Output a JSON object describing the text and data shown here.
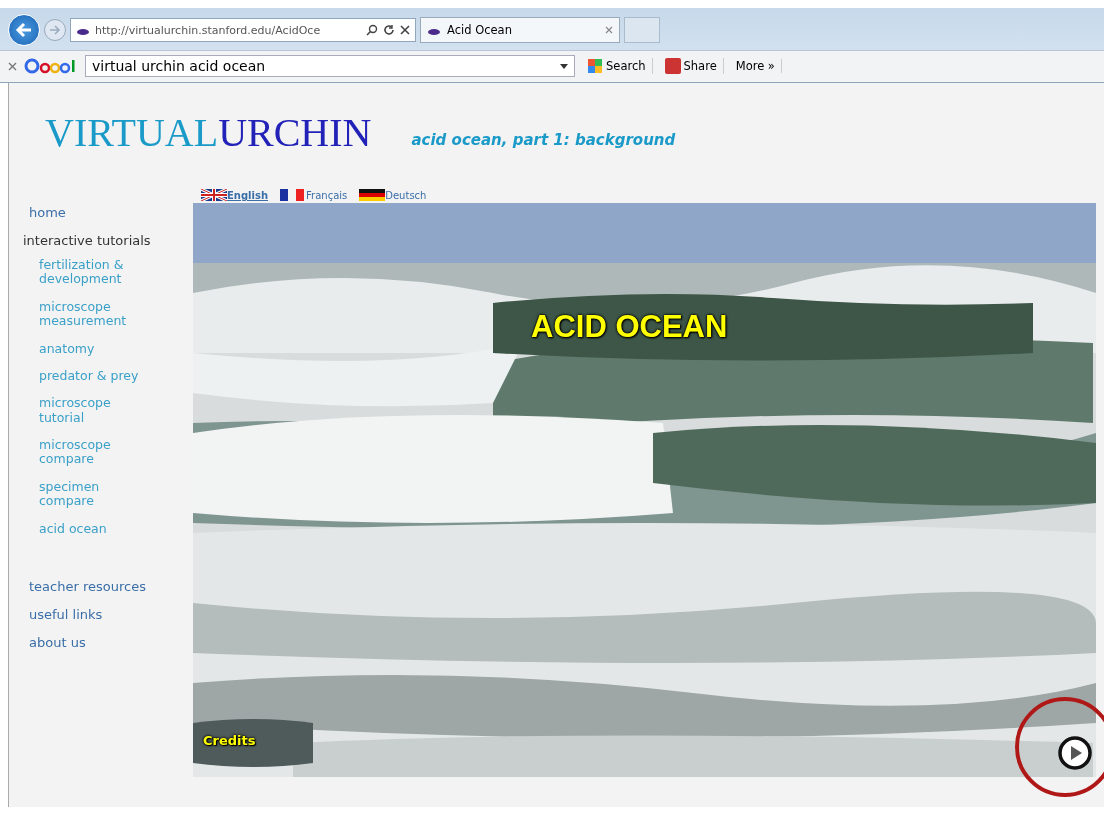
{
  "browser": {
    "address": "http://virtualurchin.stanford.edu/AcidOce",
    "tab_title": "Acid Ocean",
    "search_query": "virtual urchin acid ocean",
    "toolbar": [
      "Search",
      "Share",
      "More »"
    ]
  },
  "site": {
    "logo": [
      "VIRTUAL",
      "URCHIN"
    ],
    "subtitle": "acid ocean, part 1: background"
  },
  "languages": [
    {
      "label": "English",
      "kind": "uk",
      "selected": true
    },
    {
      "label": "Français",
      "kind": "fr",
      "selected": false
    },
    {
      "label": "Deutsch",
      "kind": "de",
      "selected": false
    }
  ],
  "nav": [
    {
      "label": "home"
    },
    {
      "label": "interactive tutorials",
      "children": [
        {
          "label": "fertilization &\ndevelopment"
        },
        {
          "label": "microscope\nmeasurement"
        },
        {
          "label": "anatomy"
        },
        {
          "label": "predator & prey"
        },
        {
          "label": "microscope\ntutorial"
        },
        {
          "label": "microscope\ncompare"
        },
        {
          "label": "specimen\ncompare"
        },
        {
          "label": "acid ocean"
        }
      ]
    },
    {
      "label": "teacher resources"
    },
    {
      "label": "useful links"
    },
    {
      "label": "about us"
    }
  ],
  "slide": {
    "kind": "picture",
    "title": "ACID OCEAN",
    "credits": "Credits",
    "play_highlighted": true
  }
}
